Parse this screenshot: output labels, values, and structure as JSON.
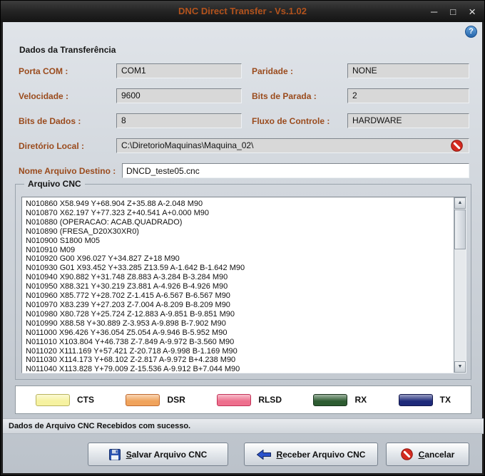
{
  "window": {
    "title": "DNC Direct Transfer - Vs.1.02",
    "minimize": "─",
    "maximize": "□",
    "close": "×",
    "help": "?"
  },
  "section_title": "Dados da Transferência",
  "fields": {
    "porta_com": {
      "label": "Porta COM :",
      "value": "COM1"
    },
    "paridade": {
      "label": "Paridade :",
      "value": "NONE"
    },
    "velocidade": {
      "label": "Velocidade :",
      "value": "9600"
    },
    "bits_parada": {
      "label": "Bits de Parada :",
      "value": "2"
    },
    "bits_dados": {
      "label": "Bits de Dados :",
      "value": "8"
    },
    "fluxo_controle": {
      "label": "Fluxo de Controle :",
      "value": "HARDWARE"
    },
    "diretorio_local": {
      "label": "Diretório Local :",
      "value": "C:\\DiretorioMaquinas\\Maquina_02\\"
    },
    "nome_arquivo_destino": {
      "label": "Nome Arquivo Destino :",
      "value": "DNCD_teste05.cnc"
    }
  },
  "cnc": {
    "group_title": "Arquivo CNC",
    "lines": [
      "N010860 X58.949 Y+68.904 Z+35.88 A-2.048 M90",
      "N010870 X62.197 Y+77.323 Z+40.541 A+0.000 M90",
      "N010880 (OPERACAO: ACAB.QUADRADO)",
      "N010890 (FRESA_D20X30XR0)",
      "N010900 S1800 M05",
      "N010910 M09",
      "N010920 G00 X96.027 Y+34.827 Z+18 M90",
      "N010930 G01 X93.452 Y+33.285 Z13.59 A-1.642 B-1.642 M90",
      "N010940 X90.882 Y+31.748 Z8.883 A-3.284 B-3.284 M90",
      "N010950 X88.321 Y+30.219 Z3.881 A-4.926 B-4.926 M90",
      "N010960 X85.772 Y+28.702 Z-1.415 A-6.567 B-6.567 M90",
      "N010970 X83.239 Y+27.203 Z-7.004 A-8.209 B-8.209 M90",
      "N010980 X80.728 Y+25.724 Z-12.883 A-9.851 B-9.851 M90",
      "N010990 X88.58 Y+30.889 Z-3.953 A-9.898 B-7.902 M90",
      "N011000 X96.426 Y+36.054 Z5.054 A-9.946 B-5.952 M90",
      "N011010 X103.804 Y+46.738 Z-7.849 A-9.972 B-3.560 M90",
      "N011020 X111.169 Y+57.421 Z-20.718 A-9.998 B-1.169 M90",
      "N011030 X114.173 Y+68.102 Z-2.817 A-9.972 B+4.238 M90",
      "N011040 X113.828 Y+79.009 Z-15.536 A-9.912 B+7.044 M90"
    ]
  },
  "icons": {
    "scroll_up": "▲",
    "scroll_down": "▼"
  },
  "legend": {
    "items": [
      {
        "label": "CTS",
        "color": "#f6f2a0",
        "border": "#b9b45e"
      },
      {
        "label": "DSR",
        "color": "#f0a35c",
        "border": "#bf6a2f"
      },
      {
        "label": "RLSD",
        "color": "#ee6f8d",
        "border": "#c23257"
      },
      {
        "label": "RX",
        "color": "#2d5c31",
        "border": "#16321a"
      },
      {
        "label": "TX",
        "color": "#1e2a7a",
        "border": "#10154b"
      }
    ]
  },
  "status": "Dados de Arquivo CNC Recebidos com sucesso.",
  "buttons": {
    "salvar": {
      "accel": "S",
      "rest": "alvar Arquivo CNC"
    },
    "receber": {
      "accel": "R",
      "rest": "eceber Arquivo CNC"
    },
    "cancelar": {
      "accel": "C",
      "rest": "ancelar"
    }
  }
}
